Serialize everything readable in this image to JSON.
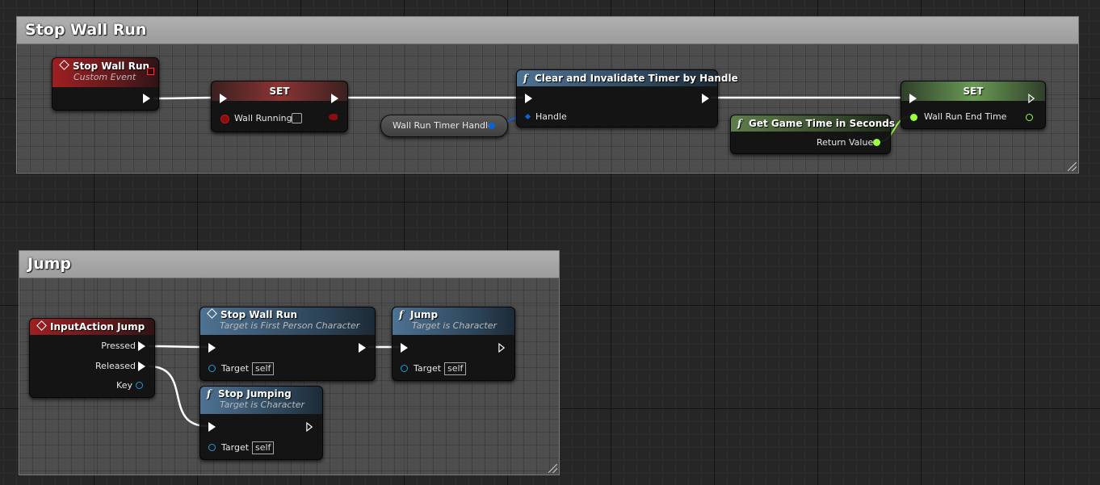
{
  "comments": {
    "stop_wall_run": "Stop Wall Run",
    "jump": "Jump"
  },
  "nodes": {
    "event_stop_wall_run": {
      "title": "Stop Wall Run",
      "subtitle": "Custom Event"
    },
    "set_wall_running": {
      "title": "SET",
      "pin_label": "Wall Running"
    },
    "var_timer_handle": {
      "label": "Wall Run Timer Handle"
    },
    "clear_timer": {
      "title": "Clear and Invalidate Timer by Handle",
      "pin_label": "Handle"
    },
    "get_game_time": {
      "title": "Get Game Time in Seconds",
      "pin_label": "Return Value"
    },
    "set_end_time": {
      "title": "SET",
      "pin_label": "Wall Run End Time"
    },
    "input_jump": {
      "title": "InputAction Jump",
      "pins": [
        "Pressed",
        "Released",
        "Key"
      ]
    },
    "call_stop_wall_run": {
      "title": "Stop Wall Run",
      "subtitle": "Target is First Person Character",
      "target_label": "Target",
      "target_value": "self"
    },
    "call_jump": {
      "title": "Jump",
      "subtitle": "Target is Character",
      "target_label": "Target",
      "target_value": "self"
    },
    "stop_jumping": {
      "title": "Stop Jumping",
      "subtitle": "Target is Character",
      "target_label": "Target",
      "target_value": "self"
    }
  },
  "icons": {
    "function": "f",
    "event": "diamond"
  },
  "colors": {
    "exec": "#ffffff",
    "bool_pin": "#8c0d0d",
    "struct_pin": "#0c63d8",
    "float_pin": "#9cfd3a",
    "object_pin": "#1a9fe0",
    "event_header": "#9e1f22",
    "function_header": "#4e7293",
    "pure_header": "#5f7d4c"
  }
}
